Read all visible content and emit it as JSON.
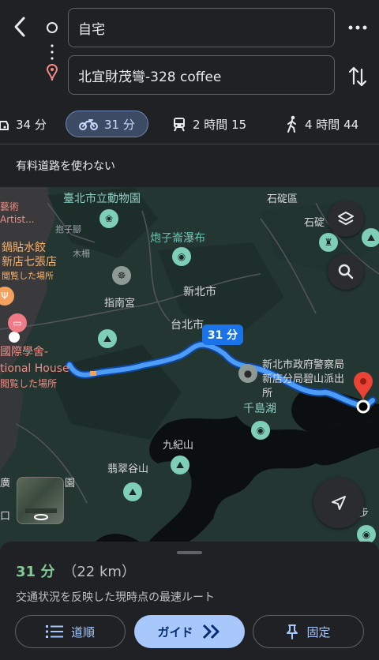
{
  "directions": {
    "origin": "自宅",
    "destination": "北宜財茂彎-328 coffee"
  },
  "modes": [
    {
      "icon": "car-icon",
      "label": "34 分"
    },
    {
      "icon": "motorcycle-icon",
      "label": "31 分"
    },
    {
      "icon": "transit-icon",
      "label": "2 時間 15"
    },
    {
      "icon": "walk-icon",
      "label": "4 時間 44"
    }
  ],
  "options": {
    "avoid_tolls": "有料道路を使わない"
  },
  "map": {
    "route_badge": "31 分",
    "labels": {
      "zoo": "臺北市立動物園",
      "shiding": "石碇區",
      "shiding2": "石碇",
      "art": "藝術",
      "artist": "Artist...",
      "baozi": "抱子腳",
      "mu": "木柵",
      "dumpling1": "鍋貼水餃",
      "dumpling2": "新店七張店",
      "visited1": "閲覧した場所",
      "paozi_falls": "炮子崙瀑布",
      "zhinan": "指南宮",
      "newtaipei": "新北市",
      "taipei": "台北市",
      "intl1": "國際學舍-",
      "intl2": "tional House",
      "visited2": "閲覧した場所",
      "police1": "新北市政府警察局",
      "police2": "新店分局碧山派出",
      "police3": "所",
      "qiandao": "千島湖",
      "jiuji": "九紀山",
      "feicui": "翡翠谷山",
      "park": "園",
      "guang": "廣",
      "kou": "口",
      "step": "步"
    },
    "accent": "#4285f4"
  },
  "summary": {
    "time": "31 分",
    "distance": "（22 km）",
    "note": "交通状況を反映した現時点の最速ルート"
  },
  "buttons": {
    "steps": "道順",
    "guide": "ガイド",
    "pin": "固定"
  }
}
